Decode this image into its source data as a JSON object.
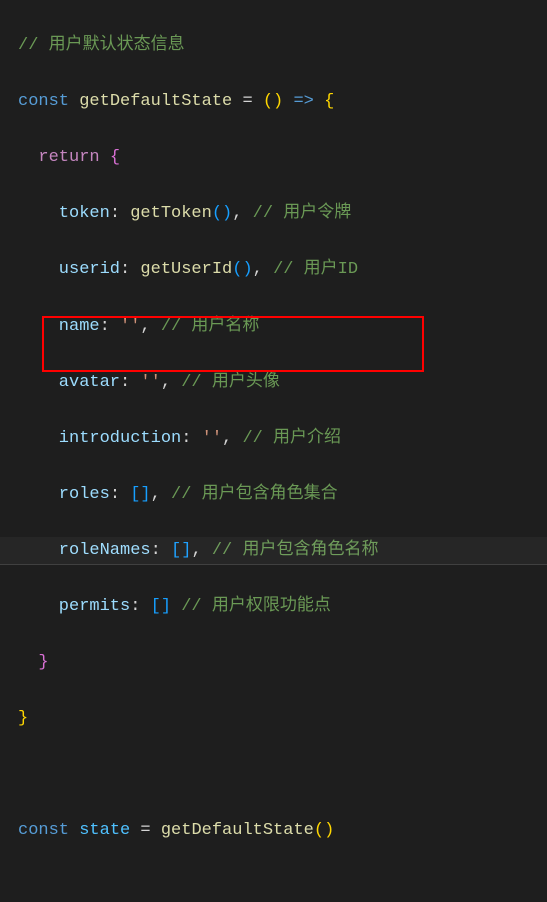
{
  "code": {
    "l1_comment": "// 用户默认状态信息",
    "l2_const": "const",
    "l2_name": "getDefaultState",
    "l2_eq": " = ",
    "l2_arrow": " => ",
    "l3_return": "return",
    "p1_key": "token",
    "p1_val": "getToken",
    "p1_comment": "// 用户令牌",
    "p2_key": "userid",
    "p2_val": "getUserId",
    "p2_comment": "// 用户ID",
    "p3_key": "name",
    "p3_val": "''",
    "p3_comment": "// 用户名称",
    "p4_key": "avatar",
    "p4_val": "''",
    "p4_comment": "// 用户头像",
    "p5_key": "introduction",
    "p5_val": "''",
    "p5_comment": "// 用户介绍",
    "p6_key": "roles",
    "p6_comment": "// 用户包含角色集合",
    "p7_key": "roleNames",
    "p7_comment": "// 用户包含角色名称",
    "p8_key": "permits",
    "p8_comment": "// 用户权限功能点",
    "l15_const": "const",
    "l15_name": "state",
    "l15_call": "getDefaultState"
  }
}
